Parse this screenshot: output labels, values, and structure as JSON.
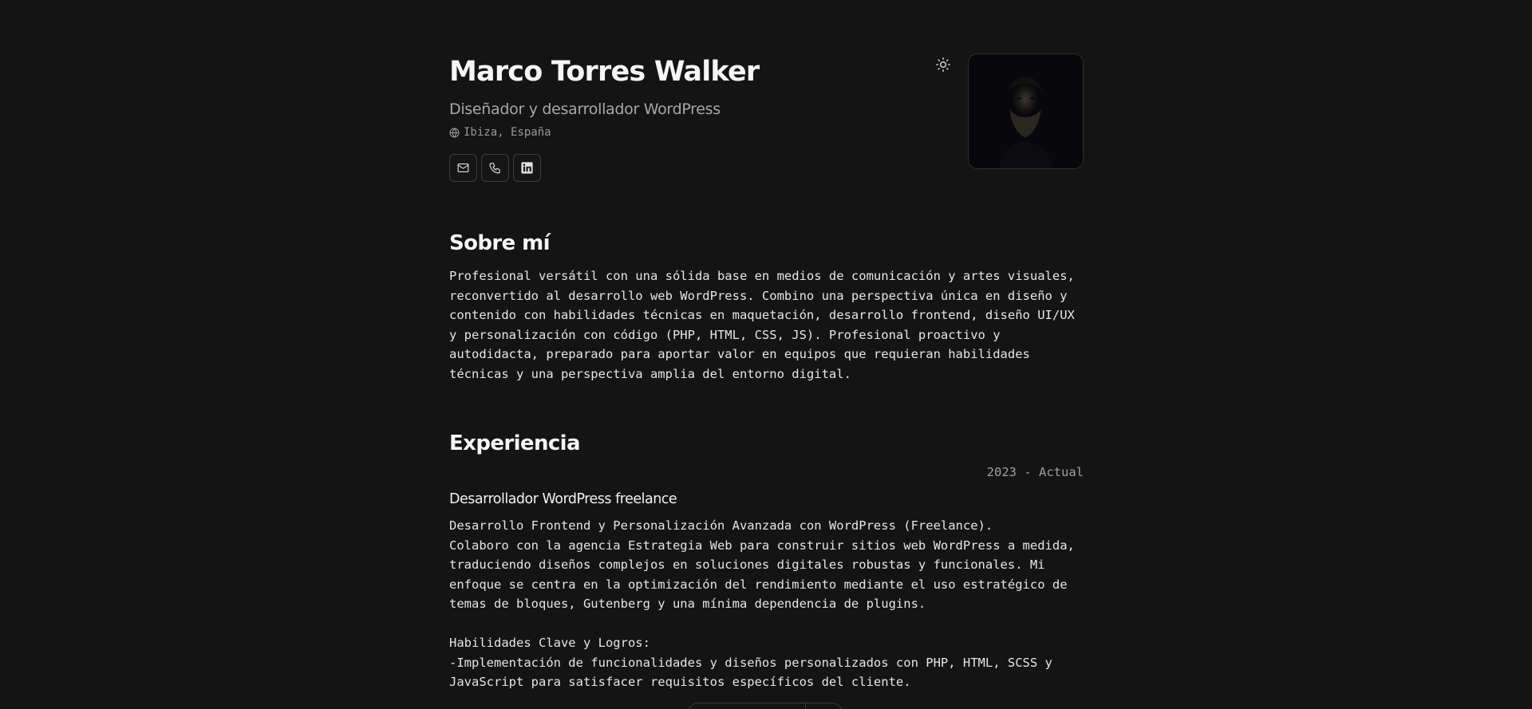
{
  "header": {
    "name": "Marco Torres Walker",
    "role": "Diseñador y desarrollador WordPress",
    "location": "Ibiza, España",
    "location_icon": "globe-icon",
    "contacts": [
      {
        "icon": "mail-icon",
        "label": "Email"
      },
      {
        "icon": "phone-icon",
        "label": "Teléfono"
      },
      {
        "icon": "linkedin-icon",
        "label": "LinkedIn"
      }
    ],
    "theme_icon": "sun-icon"
  },
  "about": {
    "title": "Sobre mí",
    "text": "Profesional versátil con una sólida base en medios de comunicación y artes visuales, reconvertido al desarrollo web WordPress. Combino una perspectiva única en diseño y contenido con habilidades técnicas en maquetación, desarrollo frontend, diseño UI/UX y personalización con código (PHP, HTML, CSS, JS). Profesional proactivo y autodidacta, preparado para aportar valor en equipos que requieran habilidades técnicas y una perspectiva amplia del entorno digital."
  },
  "experience": {
    "title": "Experiencia",
    "items": [
      {
        "period": "2023 - Actual",
        "role": "Desarrollador WordPress freelance",
        "description": "Desarrollo Frontend y Personalización Avanzada con WordPress (Freelance).\nColaboro con la agencia Estrategia Web para construir sitios web WordPress a medida, traduciendo diseños complejos en soluciones digitales robustas y funcionales. Mi enfoque se centra en la optimización del rendimiento mediante el uso estratégico de temas de bloques, Gutenberg y una mínima dependencia de plugins.\n\nHabilidades Clave y Logros:\n-Implementación de funcionalidades y diseños personalizados con PHP, HTML, SCSS y JavaScript para satisfacer requisitos específicos del cliente."
      }
    ]
  },
  "colors": {
    "background": "#141414",
    "text": "#ededed",
    "muted": "#a0a0a0",
    "border": "#3e3e3e"
  }
}
